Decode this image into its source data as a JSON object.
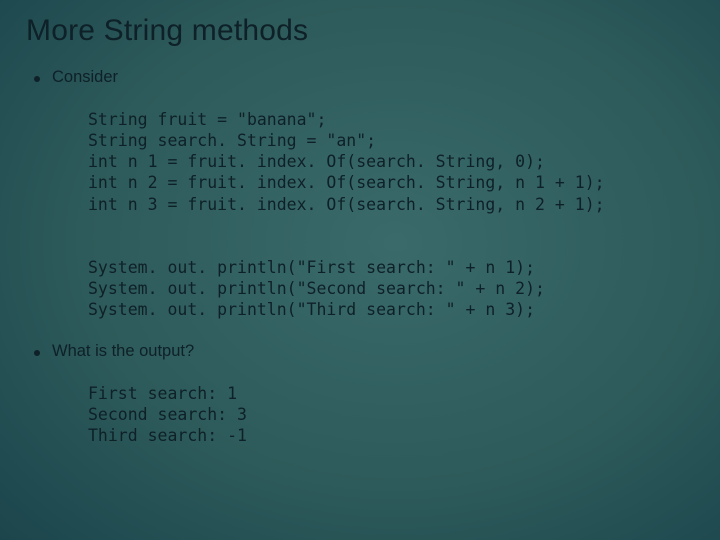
{
  "title": "More String methods",
  "bullets": {
    "b1": "Consider",
    "b2": "What is the output?"
  },
  "code": {
    "decl1": "String fruit = \"banana\";",
    "decl2": "String search. String = \"an\";",
    "decl3": "int n 1 = fruit. index. Of(search. String, 0);",
    "decl4": "int n 2 = fruit. index. Of(search. String, n 1 + 1);",
    "decl5": "int n 3 = fruit. index. Of(search. String, n 2 + 1);",
    "p1": "System. out. println(\"First search: \" + n 1);",
    "p2": "System. out. println(\"Second search: \" + n 2);",
    "p3": "System. out. println(\"Third search: \" + n 3);",
    "o1": "First search: 1",
    "o2": "Second search: 3",
    "o3": "Third search: -1"
  }
}
